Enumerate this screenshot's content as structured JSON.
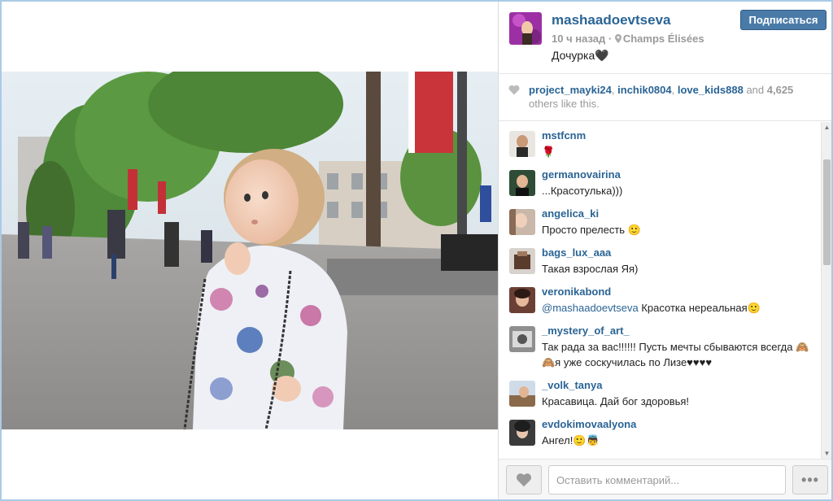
{
  "post": {
    "username": "mashaadoevtseva",
    "time": "10 ч назад",
    "separator": "·",
    "location": "Champs Élisées",
    "caption": "Дочурка🖤",
    "follow_label": "Подписаться"
  },
  "likes": {
    "users": [
      "project_mayki24",
      "inchik0804",
      "love_kids888"
    ],
    "sep1": ", ",
    "sep2": ", ",
    "and": " and ",
    "count": "4,625",
    "others": " others like this."
  },
  "comments": [
    {
      "user": "mstfcnm",
      "text": "🌹"
    },
    {
      "user": "germanovairina",
      "text": "...Красотулька)))"
    },
    {
      "user": "angelica_ki",
      "text": "Просто прелесть 🙂"
    },
    {
      "user": "bags_lux_aaa",
      "text": "Такая взрослая Яя)"
    },
    {
      "user": "veronikabond",
      "mention": "@mashaadoevtseva",
      "text": " Красотка нереальная🙂"
    },
    {
      "user": "_mystery_of_art_",
      "text": "Так рада за вас!!!!!! Пусть мечты сбываются всегда 🙈🙈я уже соскучилась по Лизе♥♥♥♥"
    },
    {
      "user": "_volk_tanya",
      "text": "Красавица. Дай бог здоровья!"
    },
    {
      "user": "evdokimovaalyona",
      "text": "Ангел!🙂👼"
    }
  ],
  "footer": {
    "comment_placeholder": "Оставить комментарий...",
    "more_label": "•••"
  },
  "colors": {
    "link": "#2a6495",
    "follow_bg": "#4a7ba8",
    "frame_border": "#a9cbe6"
  },
  "icons": [
    "location-pin-icon",
    "heart-icon",
    "more-icon",
    "scroll-up-icon",
    "scroll-down-icon"
  ]
}
